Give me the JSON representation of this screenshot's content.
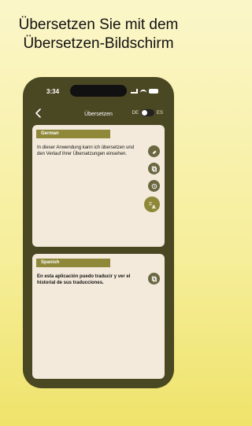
{
  "headline": "Übersetzen Sie mit dem Übersetzen-Bildschirm",
  "status": {
    "time": "3:34"
  },
  "nav": {
    "title": "Übersetzen",
    "lang_left": "DE",
    "lang_right": "ES"
  },
  "source": {
    "language": "German",
    "text": "In dieser Anwendung kann ich übersetzen und den Verlauf ihrer Übersetzungen einsehen."
  },
  "target": {
    "language": "Spanish",
    "text": "En esta aplicación puedo traducir y ver el historial de sus traducciones."
  },
  "colors": {
    "accent": "#8e8838",
    "frame": "#4a4723",
    "card": "#f3eadb"
  }
}
